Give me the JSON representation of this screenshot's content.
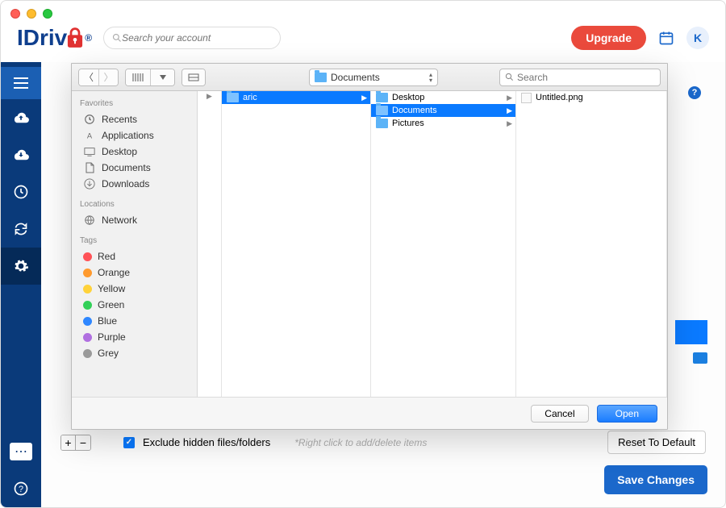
{
  "header": {
    "brand_prefix": "IDriv",
    "brand_highlight": "e",
    "brand_reg": "®",
    "search_placeholder": "Search your account",
    "upgrade_label": "Upgrade",
    "avatar_letter": "K"
  },
  "bottom": {
    "exclude_label": "Exclude hidden files/folders",
    "hint": "*Right click to add/delete items",
    "reset_label": "Reset To Default",
    "save_label": "Save Changes"
  },
  "dialog": {
    "path_label": "Documents",
    "search_placeholder": "Search",
    "sidebar": {
      "favorites_head": "Favorites",
      "favorites": [
        "Recents",
        "Applications",
        "Desktop",
        "Documents",
        "Downloads"
      ],
      "locations_head": "Locations",
      "locations": [
        "Network"
      ],
      "tags_head": "Tags",
      "tags": [
        {
          "label": "Red",
          "color": "#ff5257"
        },
        {
          "label": "Orange",
          "color": "#ff9a2e"
        },
        {
          "label": "Yellow",
          "color": "#ffd23a"
        },
        {
          "label": "Green",
          "color": "#32d058"
        },
        {
          "label": "Blue",
          "color": "#2f87ff"
        },
        {
          "label": "Purple",
          "color": "#b06fe0"
        },
        {
          "label": "Grey",
          "color": "#9a9a9a"
        }
      ]
    },
    "col2_selected": "aric",
    "col3": [
      {
        "label": "Desktop",
        "selected": false
      },
      {
        "label": "Documents",
        "selected": true
      },
      {
        "label": "Pictures",
        "selected": false
      }
    ],
    "col4": [
      {
        "label": "Untitled.png",
        "type": "file"
      }
    ],
    "cancel_label": "Cancel",
    "open_label": "Open"
  }
}
